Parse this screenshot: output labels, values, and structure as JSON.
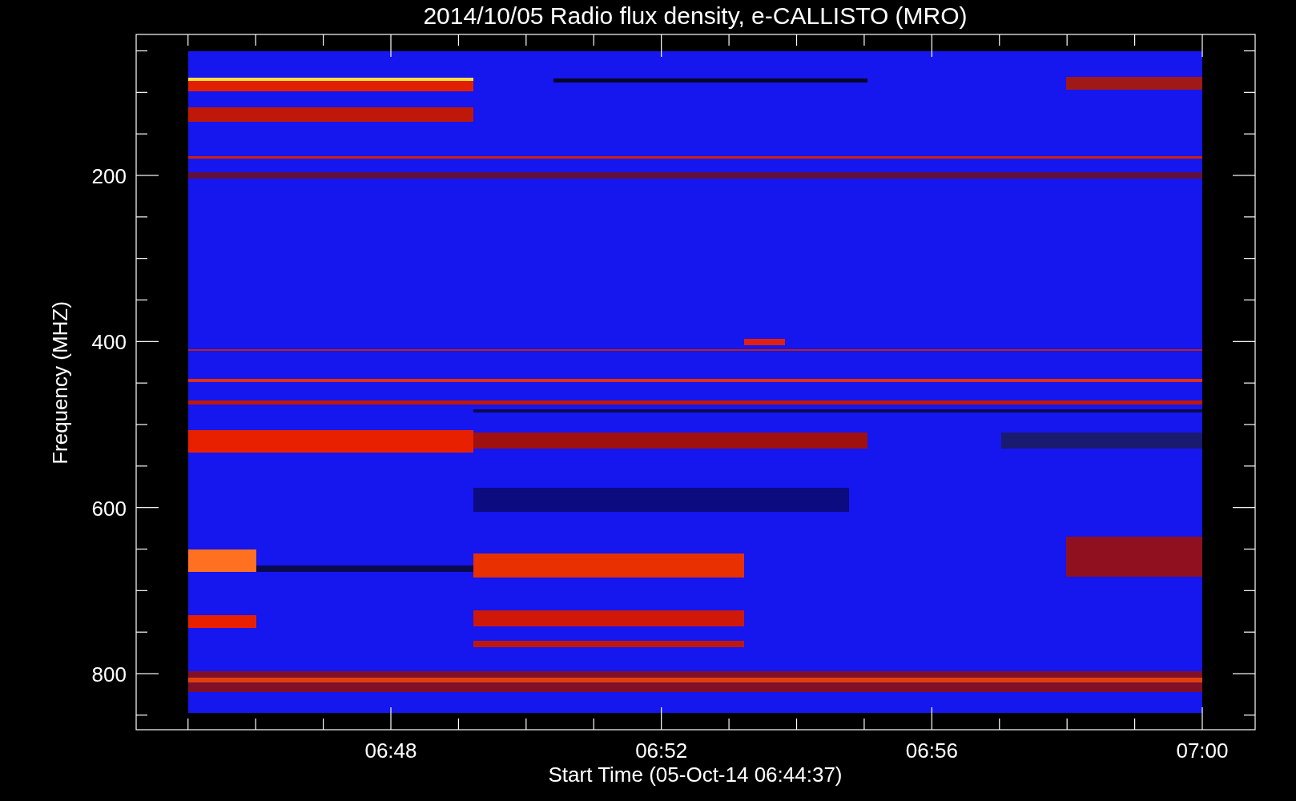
{
  "title": "2014/10/05  Radio flux density, e-CALLISTO (MRO)",
  "ylabel": "Frequency (MHZ)",
  "xlabel": "Start Time (05-Oct-14 06:44:37)",
  "yticks": [
    "200",
    "400",
    "600",
    "800"
  ],
  "xticks": [
    "06:48",
    "06:52",
    "06:56",
    "07:00"
  ]
}
